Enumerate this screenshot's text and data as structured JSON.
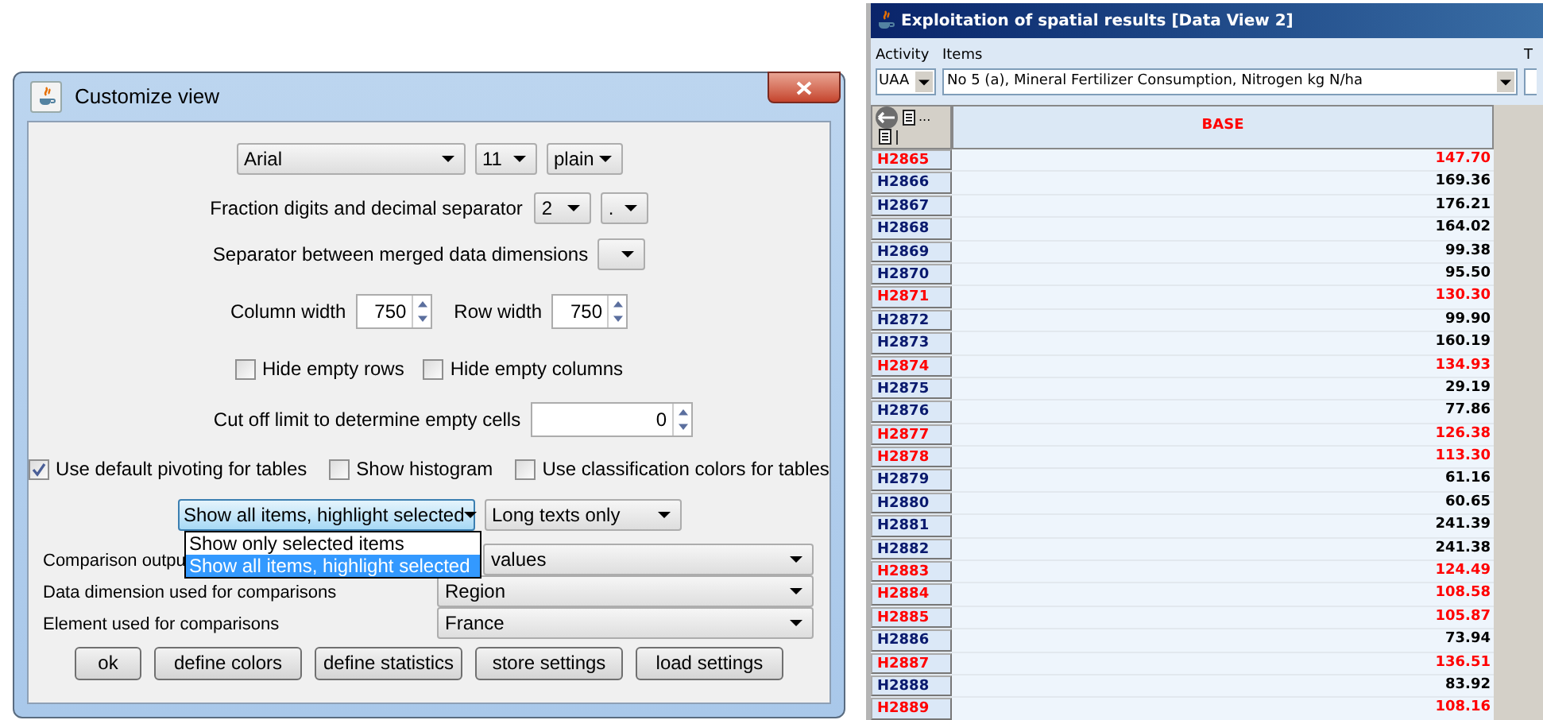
{
  "dialog": {
    "title": "Customize view",
    "font": {
      "family": "Arial",
      "size": "11",
      "style": "plain"
    },
    "fraction": {
      "label": "Fraction digits and decimal separator",
      "digits": "2",
      "separator": "."
    },
    "merge_separator": {
      "label": "Separator between merged data dimensions"
    },
    "column_width": {
      "label": "Column width",
      "value": "750"
    },
    "row_width": {
      "label": "Row width",
      "value": "750"
    },
    "hide_options": [
      {
        "label": "Hide empty rows",
        "checked": false
      },
      {
        "label": "Hide empty columns",
        "checked": false
      }
    ],
    "cutoff": {
      "label": "Cut off limit to determine empty cells",
      "value": "0"
    },
    "table_options": [
      {
        "label": "Use default pivoting for tables",
        "checked": true
      },
      {
        "label": "Show histogram",
        "checked": false
      },
      {
        "label": "Use classification colors for tables",
        "checked": false
      }
    ],
    "item_display": {
      "value": "Show all items, highlight selected",
      "expanded": true,
      "options": [
        {
          "label": "Show only selected items",
          "selected": false
        },
        {
          "label": "Show all items, highlight selected",
          "selected": true
        }
      ]
    },
    "text_display": {
      "value": "Long texts only"
    },
    "comparison_fields": [
      {
        "label": "Comparison outpu",
        "value": "values"
      },
      {
        "label": "Data dimension used for comparisons",
        "value": "Region"
      },
      {
        "label": "Element used for comparisons",
        "value": "France"
      }
    ],
    "buttons": [
      "ok",
      "define colors",
      "define statistics",
      "store settings",
      "load settings"
    ]
  },
  "data_view": {
    "title": "Exploitation of spatial results [Data View 2]",
    "activity": {
      "label": "Activity",
      "value": "UAA"
    },
    "items": {
      "label": "Items",
      "value": "No 5 (a), Mineral Fertilizer Consumption, Nitrogen kg N/ha"
    },
    "column_3": {
      "label": "T"
    },
    "table": {
      "corner_more": "...",
      "header": "BASE",
      "rows": [
        {
          "label": "H2865",
          "value": "147.70",
          "highlighted": true
        },
        {
          "label": "H2866",
          "value": "169.36",
          "highlighted": false
        },
        {
          "label": "H2867",
          "value": "176.21",
          "highlighted": false
        },
        {
          "label": "H2868",
          "value": "164.02",
          "highlighted": false
        },
        {
          "label": "H2869",
          "value": "99.38",
          "highlighted": false
        },
        {
          "label": "H2870",
          "value": "95.50",
          "highlighted": false
        },
        {
          "label": "H2871",
          "value": "130.30",
          "highlighted": true
        },
        {
          "label": "H2872",
          "value": "99.90",
          "highlighted": false
        },
        {
          "label": "H2873",
          "value": "160.19",
          "highlighted": false
        },
        {
          "label": "H2874",
          "value": "134.93",
          "highlighted": true
        },
        {
          "label": "H2875",
          "value": "29.19",
          "highlighted": false
        },
        {
          "label": "H2876",
          "value": "77.86",
          "highlighted": false
        },
        {
          "label": "H2877",
          "value": "126.38",
          "highlighted": true
        },
        {
          "label": "H2878",
          "value": "113.30",
          "highlighted": true
        },
        {
          "label": "H2879",
          "value": "61.16",
          "highlighted": false
        },
        {
          "label": "H2880",
          "value": "60.65",
          "highlighted": false
        },
        {
          "label": "H2881",
          "value": "241.39",
          "highlighted": false
        },
        {
          "label": "H2882",
          "value": "241.38",
          "highlighted": false
        },
        {
          "label": "H2883",
          "value": "124.49",
          "highlighted": true
        },
        {
          "label": "H2884",
          "value": "108.58",
          "highlighted": true
        },
        {
          "label": "H2885",
          "value": "105.87",
          "highlighted": true
        },
        {
          "label": "H2886",
          "value": "73.94",
          "highlighted": false
        },
        {
          "label": "H2887",
          "value": "136.51",
          "highlighted": true
        },
        {
          "label": "H2888",
          "value": "83.92",
          "highlighted": false
        },
        {
          "label": "H2889",
          "value": "108.16",
          "highlighted": true
        }
      ]
    }
  }
}
